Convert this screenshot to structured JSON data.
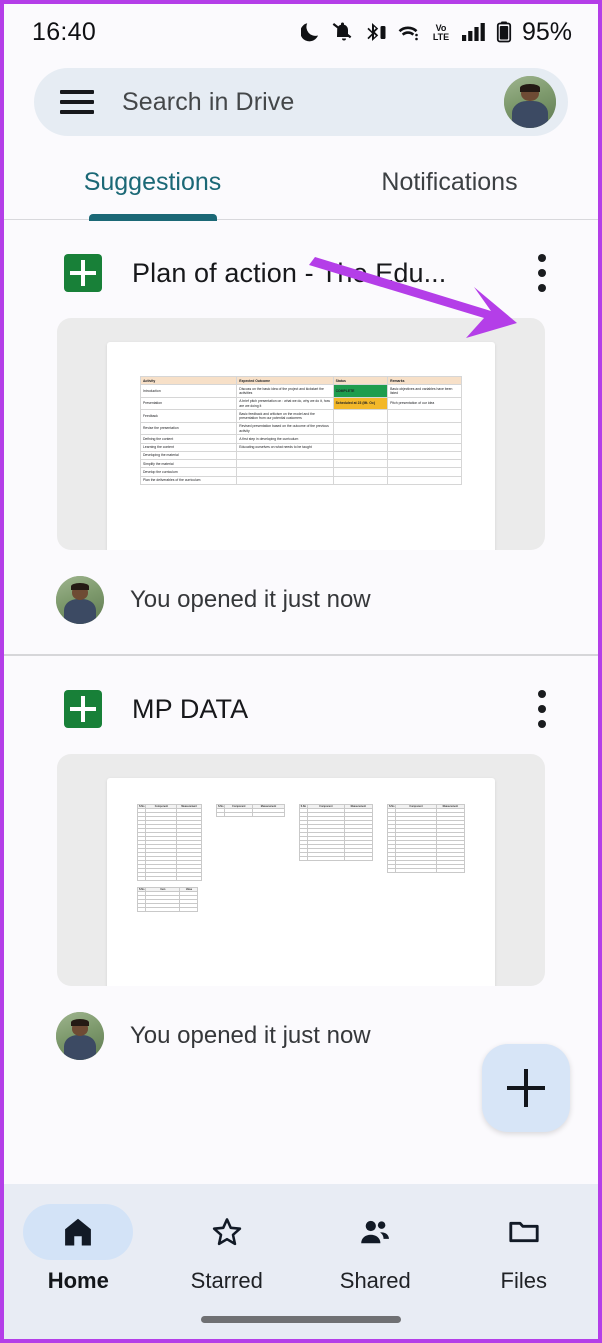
{
  "status_bar": {
    "time": "16:40",
    "battery_percent": "95%",
    "icons": [
      "dnd-moon-icon",
      "bell-muted-icon",
      "bluetooth-icon",
      "wifi-icon",
      "volte-icon",
      "signal-bars-icon",
      "battery-icon"
    ]
  },
  "search": {
    "placeholder": "Search in Drive",
    "menu_icon": "hamburger-icon",
    "avatar": "account-avatar"
  },
  "tabs": [
    {
      "label": "Suggestions",
      "active": true
    },
    {
      "label": "Notifications",
      "active": false
    }
  ],
  "colors": {
    "accent_teal": "#1b6876",
    "sheets_green": "#188038",
    "annotation_purple": "#b43ee8",
    "nav_background": "#e8ecf4",
    "fab_background": "#d7e5f7",
    "search_background": "#e6ecf3"
  },
  "files": [
    {
      "title": "Plan of action - The Edu...",
      "icon": "google-sheets-icon",
      "menu_icon": "kebab-menu-icon",
      "attribution": "You opened it just now",
      "thumbnail": {
        "type": "spreadsheet",
        "headers": [
          "Activity",
          "Expected Outcome",
          "Status",
          "Remarks"
        ],
        "rows": [
          {
            "activity": "Introduction",
            "outcome": "Discuss on the basic idea of the project and kickstart the activities",
            "status": "COMPLETE",
            "status_style": "complete",
            "remarks": "Basic objectives and variables have been listed"
          },
          {
            "activity": "Presentation",
            "outcome": "A brief pitch presentation on : what we do, why we do it, how are we doing it",
            "status": "Scheduled at 23 (Mt. Oc)",
            "status_style": "scheduled",
            "remarks": "Pitch presentation of our idea"
          },
          {
            "activity": "Feedback",
            "outcome": "Basic feedback and criticism on the model and the presentation from our potential customers",
            "status": "",
            "status_style": "",
            "remarks": ""
          },
          {
            "activity": "Revise the presentation",
            "outcome": "Revised presentation based on the outcome of the previous activity",
            "status": "",
            "status_style": "",
            "remarks": ""
          },
          {
            "activity": "Defining the content",
            "outcome": "A first step in developing the curriculum",
            "status": "",
            "status_style": "",
            "remarks": ""
          },
          {
            "activity": "Learning the content",
            "outcome": "Educating ourselves on what needs to be taught",
            "status": "",
            "status_style": "",
            "remarks": ""
          },
          {
            "activity": "Developing the material",
            "outcome": "",
            "status": "",
            "status_style": "",
            "remarks": ""
          },
          {
            "activity": "Simplify the material",
            "outcome": "",
            "status": "",
            "status_style": "",
            "remarks": ""
          },
          {
            "activity": "Develop the curriculum",
            "outcome": "",
            "status": "",
            "status_style": "",
            "remarks": ""
          },
          {
            "activity": "Plan the deliverables of the curriculum",
            "outcome": "",
            "status": "",
            "status_style": "",
            "remarks": ""
          }
        ]
      }
    },
    {
      "title": "MP DATA",
      "icon": "google-sheets-icon",
      "menu_icon": "kebab-menu-icon",
      "attribution": "You opened it just now",
      "thumbnail": {
        "type": "spreadsheet-multi",
        "tables": [
          {
            "headers": [
              "S.No",
              "Component",
              "Measurement"
            ],
            "row_count": 18
          },
          {
            "headers": [
              "S.No",
              "Component",
              "Measurement"
            ],
            "row_count": 2
          },
          {
            "headers": [
              "S.No",
              "Component",
              "Measurement"
            ],
            "row_count": 13
          },
          {
            "headers": [
              "S.No",
              "Component",
              "Measurement"
            ],
            "row_count": 16
          },
          {
            "headers": [
              "S.No",
              "Item",
              "Value"
            ],
            "row_count": 5
          }
        ]
      }
    }
  ],
  "fab": {
    "label": "+",
    "icon": "plus-icon"
  },
  "bottom_nav": [
    {
      "label": "Home",
      "icon": "home-icon",
      "active": true
    },
    {
      "label": "Starred",
      "icon": "star-icon",
      "active": false
    },
    {
      "label": "Shared",
      "icon": "people-icon",
      "active": false
    },
    {
      "label": "Files",
      "icon": "folder-icon",
      "active": false
    }
  ],
  "annotation": {
    "type": "arrow",
    "color": "#b43ee8",
    "points_at": "kebab-menu-icon"
  }
}
